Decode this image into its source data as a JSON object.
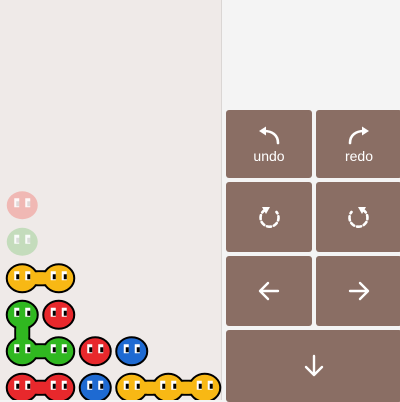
{
  "buttons": {
    "undo": {
      "label": "undo",
      "icon": "undo-arrow-icon"
    },
    "redo": {
      "label": "redo",
      "icon": "redo-arrow-icon"
    },
    "rotate_ccw": {
      "icon": "rotate-counterclockwise-icon"
    },
    "rotate_cw": {
      "icon": "rotate-clockwise-icon"
    },
    "left": {
      "icon": "arrow-left-icon"
    },
    "right": {
      "icon": "arrow-right-icon"
    },
    "down": {
      "icon": "arrow-down-icon"
    }
  },
  "colors": {
    "board_bg": "#efeae8",
    "panel_bg": "#f4f4f4",
    "button_bg": "#8a6e64",
    "red": "#e8282c",
    "yellow": "#f8b814",
    "green": "#30b820",
    "blue": "#1e6ad2",
    "ghost_red": "#f0b8b4",
    "ghost_green": "#c4dcbc"
  },
  "board": {
    "columns": 6,
    "blobs": [
      {
        "color": "ghost_red",
        "col": 0,
        "row": 5
      },
      {
        "color": "ghost_green",
        "col": 0,
        "row": 6
      },
      {
        "color": "yellow",
        "col": 0,
        "row": 7,
        "link_right": true
      },
      {
        "color": "yellow",
        "col": 1,
        "row": 7
      },
      {
        "color": "green",
        "col": 0,
        "row": 8,
        "link_down": true
      },
      {
        "color": "red",
        "col": 1,
        "row": 8
      },
      {
        "color": "green",
        "col": 0,
        "row": 9,
        "link_right": true
      },
      {
        "color": "green",
        "col": 1,
        "row": 9
      },
      {
        "color": "red",
        "col": 2,
        "row": 9
      },
      {
        "color": "blue",
        "col": 3,
        "row": 9
      },
      {
        "color": "red",
        "col": 0,
        "row": 10,
        "link_right": true
      },
      {
        "color": "red",
        "col": 1,
        "row": 10
      },
      {
        "color": "blue",
        "col": 2,
        "row": 10
      },
      {
        "color": "yellow",
        "col": 3,
        "row": 10,
        "link_right": true
      },
      {
        "color": "yellow",
        "col": 4,
        "row": 10,
        "link_right": true
      },
      {
        "color": "yellow",
        "col": 5,
        "row": 10
      }
    ]
  }
}
